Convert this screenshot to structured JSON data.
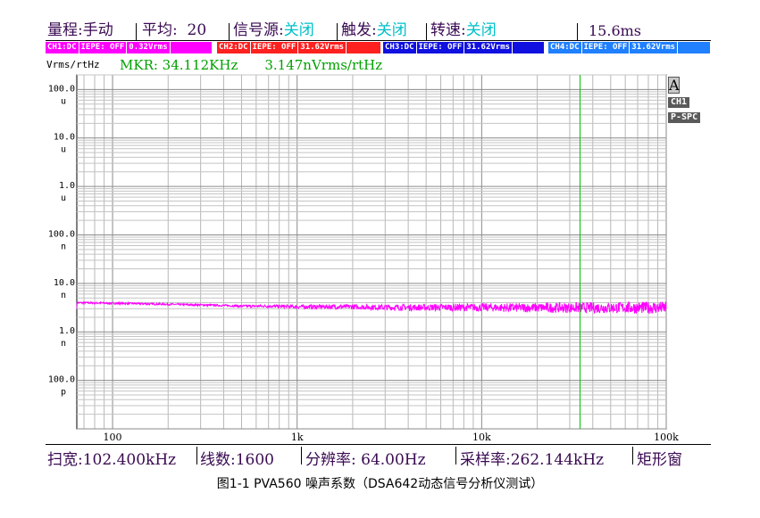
{
  "status_bar": {
    "range_label": "量程:",
    "range_value": "手动",
    "avg_label": "平均:",
    "avg_value": "20",
    "source_label": "信号源:",
    "source_value": "关闭",
    "trigger_label": "触发:",
    "trigger_value": "关闭",
    "speed_label": "转速:",
    "speed_value": "关闭",
    "time_value": "15.6ms"
  },
  "channels": [
    {
      "name": "CH1:DC",
      "iepe": "IEPE: OFF",
      "range": "0.32Vrms",
      "color": "#ff00ff"
    },
    {
      "name": "CH2:DC",
      "iepe": "IEPE: OFF",
      "range": "31.62Vrms",
      "color": "#ff2020"
    },
    {
      "name": "CH3:DC",
      "iepe": "IEPE: OFF",
      "range": "31.62Vrms",
      "color": "#1010e0"
    },
    {
      "name": "CH4:DC",
      "iepe": "IEPE: OFF",
      "range": "31.62Vrms",
      "color": "#2080ff"
    }
  ],
  "unit_label": "Vrms/rtHz",
  "marker": {
    "freq": "MKR: 34.112KHz",
    "value": "3.147nVrms/rtHz"
  },
  "side_panel": {
    "trace": "A",
    "channel": "CH1",
    "mode": "P-SPC"
  },
  "bottom_bar": {
    "span_label": "扫宽:",
    "span_value": "102.400kHz",
    "lines_label": "线数:",
    "lines_value": "1600",
    "resolution_label": "分辨率:",
    "resolution_value": "64.00Hz",
    "sample_label": "采样率:",
    "sample_value": "262.144kHz",
    "window": "矩形窗"
  },
  "caption": "图1-1 PVA560 噪声系数（DSA642动态信号分析仪测试）",
  "chart_data": {
    "type": "line",
    "title": "",
    "xlabel": "",
    "ylabel": "Vrms/rtHz",
    "x_scale": "log",
    "y_scale": "log",
    "xlim": [
      64,
      100000
    ],
    "ylim": [
      1e-11,
      0.0002
    ],
    "x_ticks": [
      {
        "value": 100,
        "label": "100"
      },
      {
        "value": 1000,
        "label": "1k"
      },
      {
        "value": 10000,
        "label": "10k"
      },
      {
        "value": 100000,
        "label": "100k"
      }
    ],
    "y_ticks": [
      {
        "value": 0.0001,
        "label": "100.0",
        "unit": "u"
      },
      {
        "value": 1e-05,
        "label": "10.0",
        "unit": "u"
      },
      {
        "value": 1e-06,
        "label": "1.0",
        "unit": "u"
      },
      {
        "value": 1e-07,
        "label": "100.0",
        "unit": "n"
      },
      {
        "value": 1e-08,
        "label": "10.0",
        "unit": "n"
      },
      {
        "value": 1e-09,
        "label": "1.0",
        "unit": "n"
      },
      {
        "value": 1e-10,
        "label": "100.0",
        "unit": "p"
      }
    ],
    "grid": true,
    "marker_x": 34112,
    "series": [
      {
        "color": "#ff00ff",
        "x": [
          64,
          100,
          150,
          200,
          300,
          400,
          500,
          700,
          1000,
          1500,
          2000,
          3000,
          5000,
          7000,
          10000,
          15000,
          20000,
          30000,
          40000,
          60000,
          80000,
          100000
        ],
        "y": [
          4e-09,
          3.9e-09,
          3.8e-09,
          3.7e-09,
          3.6e-09,
          3.5e-09,
          3.4e-09,
          3.4e-09,
          3.3e-09,
          3.3e-09,
          3.3e-09,
          3.2e-09,
          3.2e-09,
          3.2e-09,
          3.2e-09,
          3.15e-09,
          3.15e-09,
          3.15e-09,
          3.15e-09,
          3.15e-09,
          3.15e-09,
          3.15e-09
        ]
      }
    ]
  }
}
